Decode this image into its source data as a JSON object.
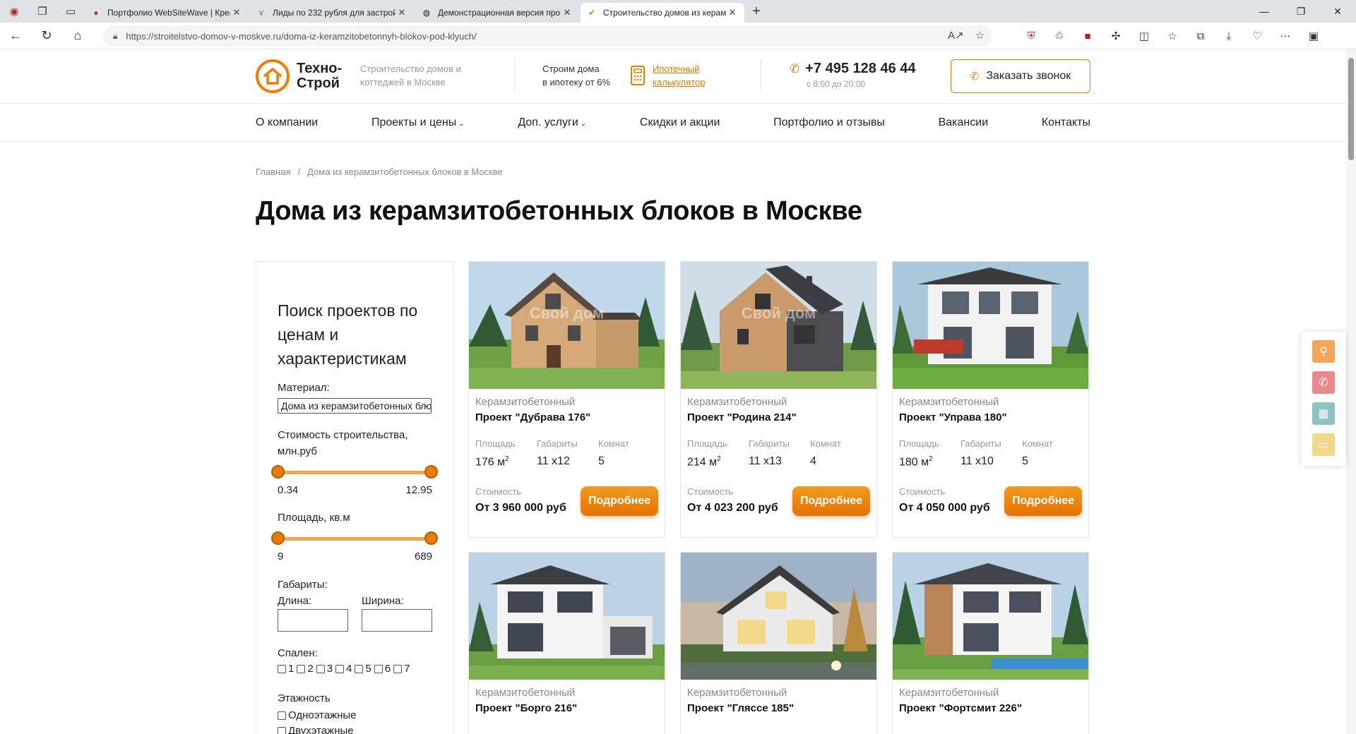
{
  "browser": {
    "tabs": [
      {
        "title": "Портфолио WebSiteWave | Креа",
        "active": false
      },
      {
        "title": "Лиды по 232 рубля для застрой",
        "active": false
      },
      {
        "title": "Демонстрационная версия про",
        "active": false
      },
      {
        "title": "Строительство домов из керам",
        "active": true
      }
    ],
    "new_tab": "+",
    "url_host": "https://stroitelstvo-domov-v-moskve.ru",
    "url_path": "/doma-iz-keramzitobetonnyh-blokov-pod-klyuch/"
  },
  "header": {
    "logo_line1": "Техно-",
    "logo_line2": "Строй",
    "tagline_1": "Строительство домов и",
    "tagline_2": "коттеджей в Москве",
    "mortgage_1": "Строим дома",
    "mortgage_2": "в ипотеку от 6%",
    "calc_1": "Ипотечный",
    "calc_2": "калькулятор",
    "phone": "+7 495 128 46 44",
    "hours": "с 8:00 до 20:00",
    "callback": "Заказать звонок"
  },
  "nav": [
    {
      "label": "О компании",
      "dropdown": false
    },
    {
      "label": "Проекты и цены",
      "dropdown": true
    },
    {
      "label": "Доп. услуги",
      "dropdown": true
    },
    {
      "label": "Скидки и акции",
      "dropdown": false
    },
    {
      "label": "Портфолио и отзывы",
      "dropdown": false
    },
    {
      "label": "Вакансии",
      "dropdown": false
    },
    {
      "label": "Контакты",
      "dropdown": false
    }
  ],
  "breadcrumb": {
    "home": "Главная",
    "sep": "/",
    "current": "Дома из керамзитобетонных блоков в Москве"
  },
  "page_title": "Дома из керамзитобетонных блоков в Москве",
  "filter": {
    "title": "Поиск проектов по ценам и характеристикам",
    "material_label": "Материал:",
    "material_value": "Дома из керамзитобетонных блоков",
    "cost_label_1": "Стоимость строительства,",
    "cost_label_2": "млн.руб",
    "cost_min": "0.34",
    "cost_max": "12.95",
    "area_label": "Площадь, кв.м",
    "area_min": "9",
    "area_max": "689",
    "dims_label": "Габариты:",
    "length_label": "Длина:",
    "width_label": "Ширина:",
    "bedrooms_label": "Спален:",
    "bedrooms": [
      "1",
      "2",
      "3",
      "4",
      "5",
      "6",
      "7"
    ],
    "floors_label": "Этажность",
    "floor_one": "Одноэтажные",
    "floor_two": "Двухэтажные"
  },
  "card_labels": {
    "area": "Площадь",
    "dims": "Габариты",
    "rooms": "Комнат",
    "price": "Стоимость",
    "more": "Подробнее",
    "area_unit": "м",
    "area_sup": "2"
  },
  "cards": [
    {
      "material": "Керамзитобетонный",
      "name": "Проект \"Дубрава 176\"",
      "area": "176",
      "dims": "11 x12",
      "rooms": "5",
      "price": "От 3 960 000 руб",
      "watermark": "Свой дом"
    },
    {
      "material": "Керамзитобетонный",
      "name": "Проект \"Родина 214\"",
      "area": "214",
      "dims": "11 x13",
      "rooms": "4",
      "price": "От 4 023 200 руб",
      "watermark": "Свой дом"
    },
    {
      "material": "Керамзитобетонный",
      "name": "Проект \"Управа 180\"",
      "area": "180",
      "dims": "11 x10",
      "rooms": "5",
      "price": "От 4 050 000 руб",
      "watermark": ""
    },
    {
      "material": "Керамзитобетонный",
      "name": "Проект \"Борго 216\""
    },
    {
      "material": "Керамзитобетонный",
      "name": "Проект \"Гляссе 185\""
    },
    {
      "material": "Керамзитобетонный",
      "name": "Проект \"Фортсмит 226\""
    }
  ],
  "colors": {
    "accent": "#f07d00",
    "button": "#e67200",
    "widget_search": "#f5a55a",
    "widget_phone": "#e98a8a",
    "widget_grid": "#8cc4c4",
    "widget_chat": "#f2d98a"
  },
  "icons": [
    "search-icon",
    "phone-icon",
    "grid-icon",
    "chat-icon"
  ]
}
